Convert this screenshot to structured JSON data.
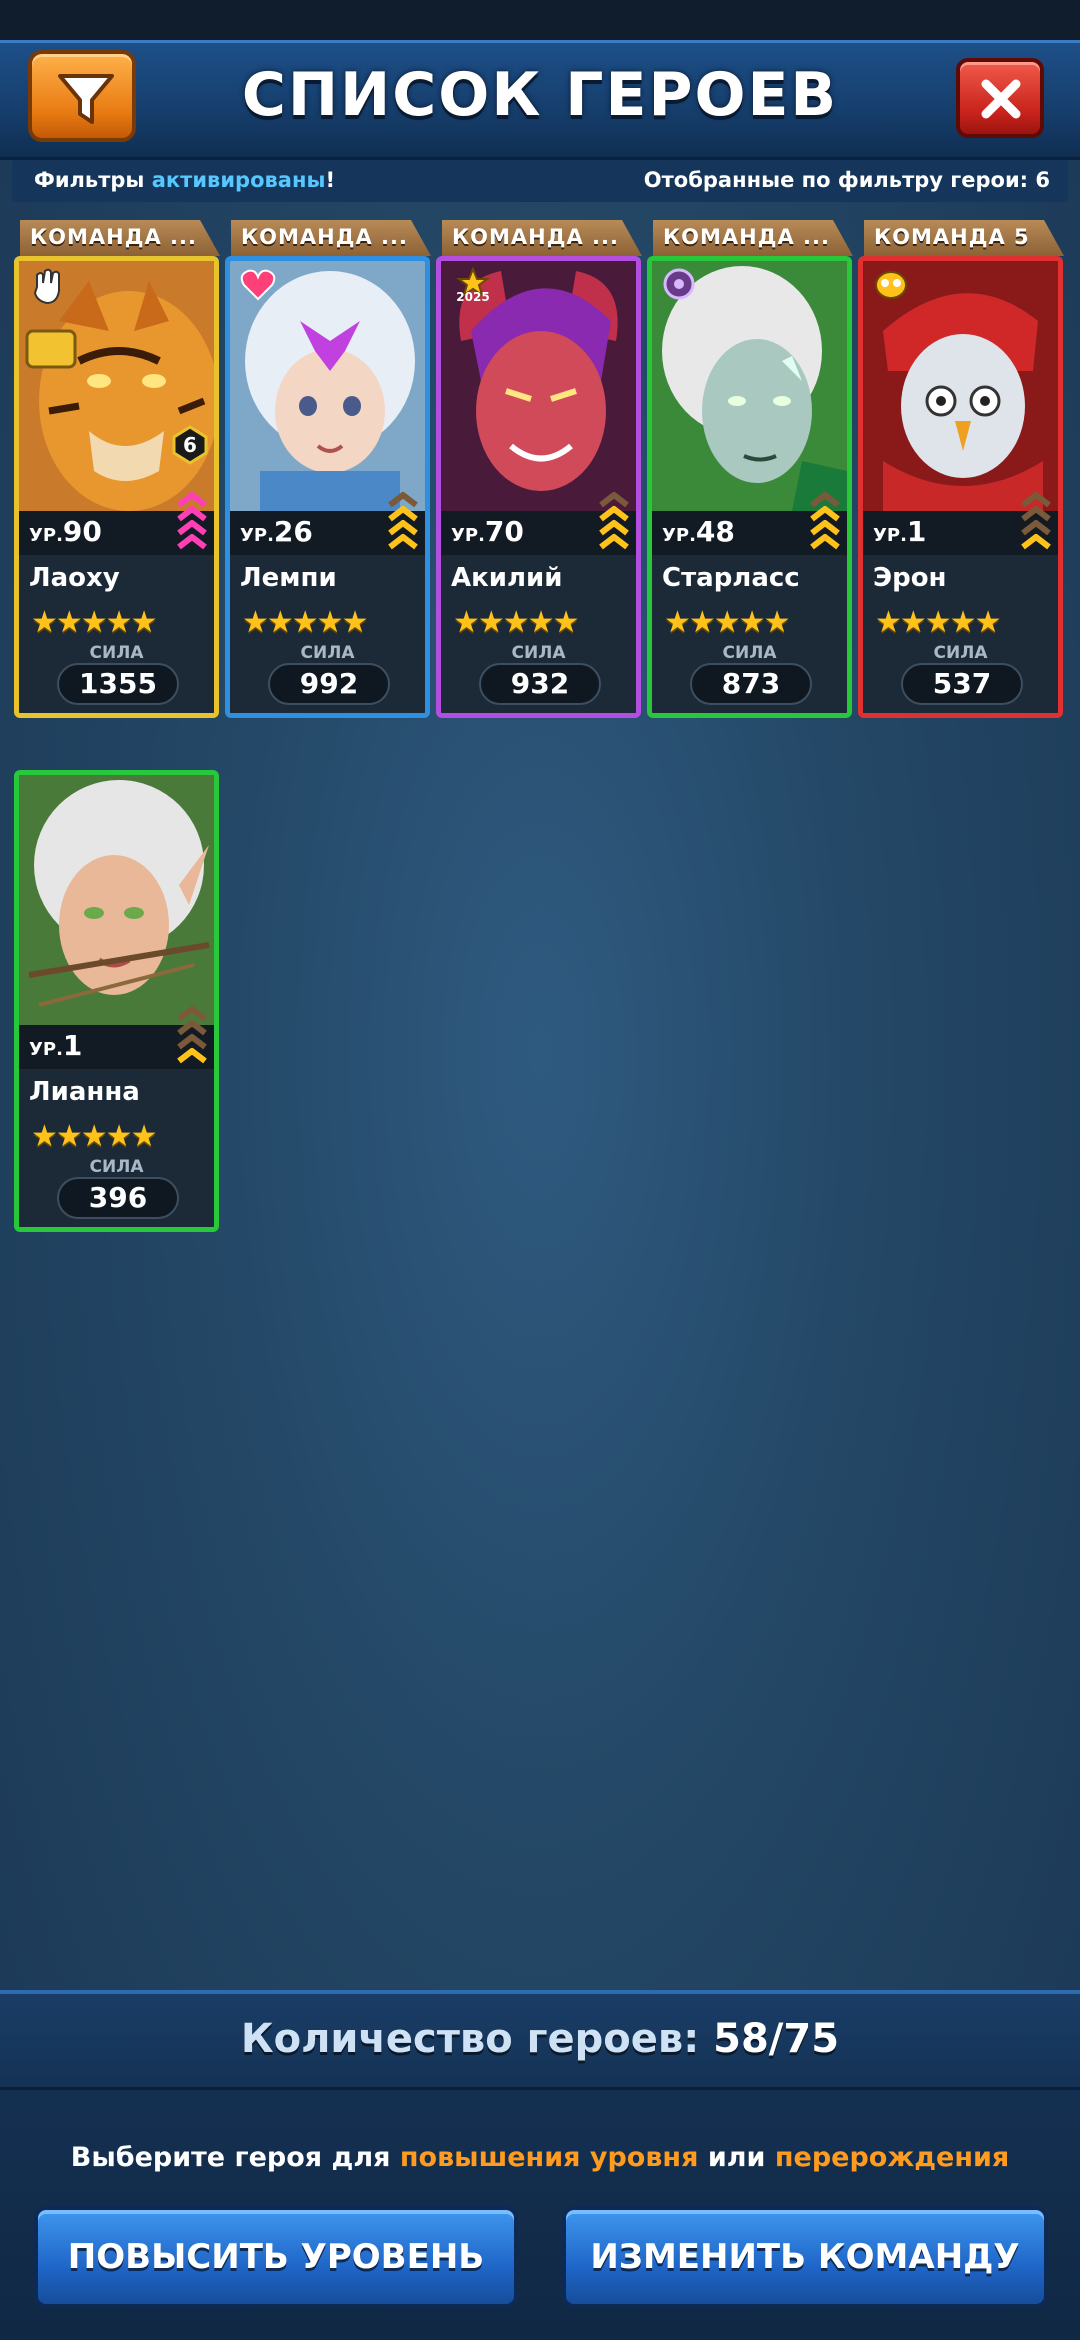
{
  "header": {
    "title": "СПИСОК ГЕРОЕВ",
    "filter_icon": "funnel-icon",
    "close_icon": "close-icon"
  },
  "filter_bar": {
    "label_prefix": "Фильтры",
    "label_highlight": "активированы",
    "label_suffix": "!",
    "filtered_text": "Отобранные по фильтру герои: 6"
  },
  "heroes": [
    {
      "team": "КОМАНДА ...",
      "level_prefix": "УР.",
      "level": "90",
      "name": "Лаоху",
      "stars": "★★★★★",
      "power_label": "СИЛА",
      "power": "1355",
      "frame_color": "#e8c32e",
      "rank_badge": "6"
    },
    {
      "team": "КОМАНДА ...",
      "level_prefix": "УР.",
      "level": "26",
      "name": "Лемпи",
      "stars": "★★★★★",
      "power_label": "СИЛА",
      "power": "992",
      "frame_color": "#2f8fe0"
    },
    {
      "team": "КОМАНДА ...",
      "level_prefix": "УР.",
      "level": "70",
      "name": "Акилий",
      "stars": "★★★★★",
      "power_label": "СИЛА",
      "power": "932",
      "frame_color": "#b44ee0",
      "event_badge": "2025"
    },
    {
      "team": "КОМАНДА ...",
      "level_prefix": "УР.",
      "level": "48",
      "name": "Старласс",
      "stars": "★★★★★",
      "power_label": "СИЛА",
      "power": "873",
      "frame_color": "#27c83a"
    },
    {
      "team": "КОМАНДА 5",
      "level_prefix": "УР.",
      "level": "1",
      "name": "Эрон",
      "stars": "★★★★★",
      "power_label": "СИЛА",
      "power": "537",
      "frame_color": "#e03030"
    },
    {
      "team": "",
      "level_prefix": "УР.",
      "level": "1",
      "name": "Лианна",
      "stars": "★★★★★",
      "power_label": "СИЛА",
      "power": "396",
      "frame_color": "#27c83a"
    }
  ],
  "footer": {
    "count_label": "Количество героев:",
    "count_value": "58/75",
    "hint_1": "Выберите героя для",
    "hint_2": "повышения уровня",
    "hint_3": "или",
    "hint_4": "перерождения",
    "level_up_button": "ПОВЫСИТЬ УРОВЕНЬ",
    "change_team_button": "ИЗМЕНИТЬ КОМАНДУ"
  }
}
